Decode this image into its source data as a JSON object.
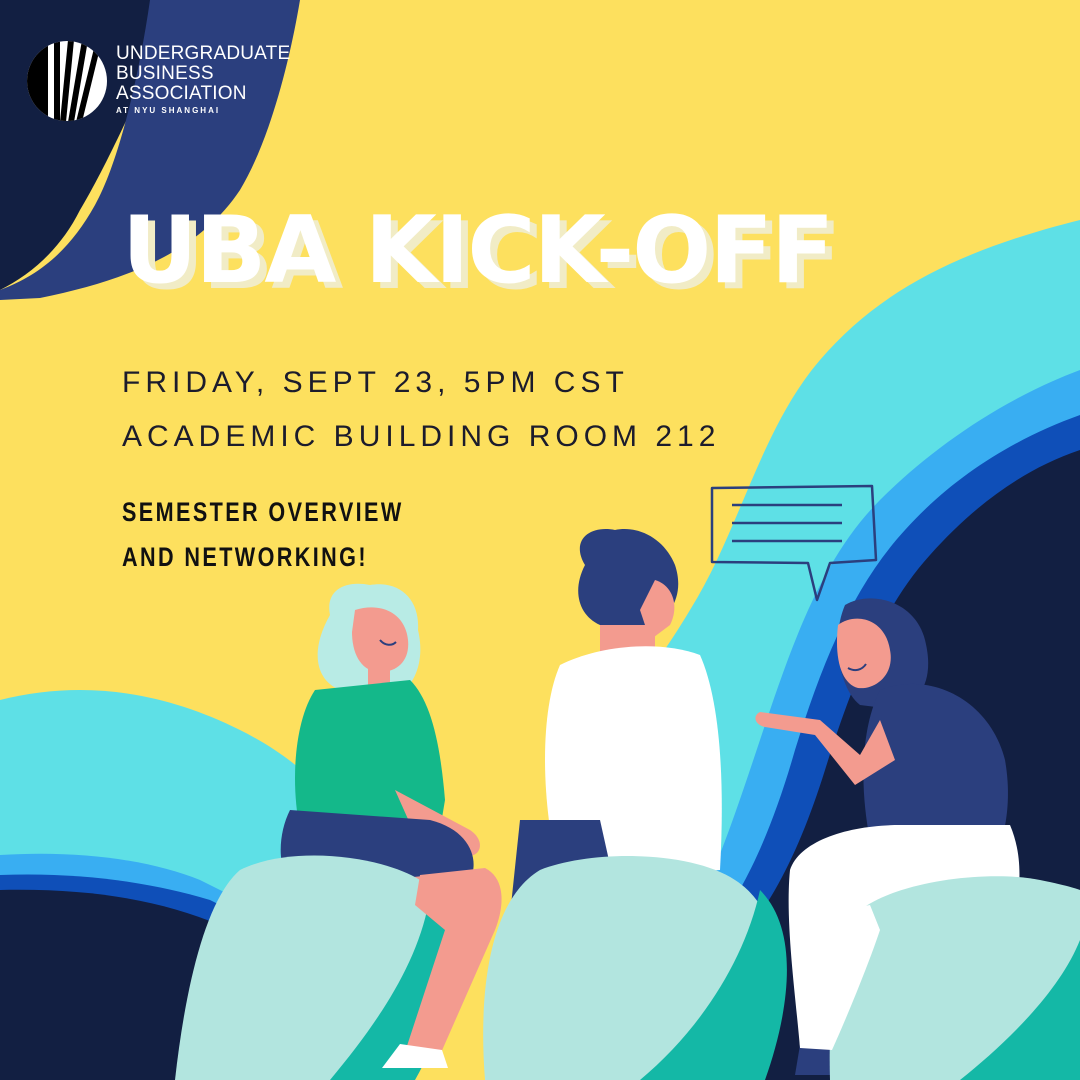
{
  "logo": {
    "lines": [
      "UNDERGRADUATE",
      "BUSINESS",
      "ASSOCIATION"
    ],
    "subline": "AT NYU SHANGHAI",
    "mark_icon": "uba-striped-circle-logo"
  },
  "event": {
    "title": "UBA KICK-OFF",
    "date_time": "FRIDAY, SEPT 23, 5PM CST",
    "location": "ACADEMIC BUILDING ROOM 212",
    "tagline_lines": [
      "SEMESTER OVERVIEW",
      "AND NETWORKING!"
    ]
  },
  "colors": {
    "background_yellow": "#fde05e",
    "navy": "#121f42",
    "royal_blue": "#2b3f7e",
    "cyan": "#5ee0e6",
    "bright_blue": "#39aef2",
    "deep_blue": "#0f4fb8",
    "mint": "#b2e5df",
    "teal": "#14b8a6",
    "skin": "#f39b8f",
    "green_top": "#14b88a",
    "title_white": "#ffffff",
    "text_dark": "#1c1c2c"
  },
  "illustration": {
    "icons": [
      "speech-bubble-icon",
      "person-left-icon",
      "person-middle-icon",
      "person-right-icon"
    ]
  }
}
